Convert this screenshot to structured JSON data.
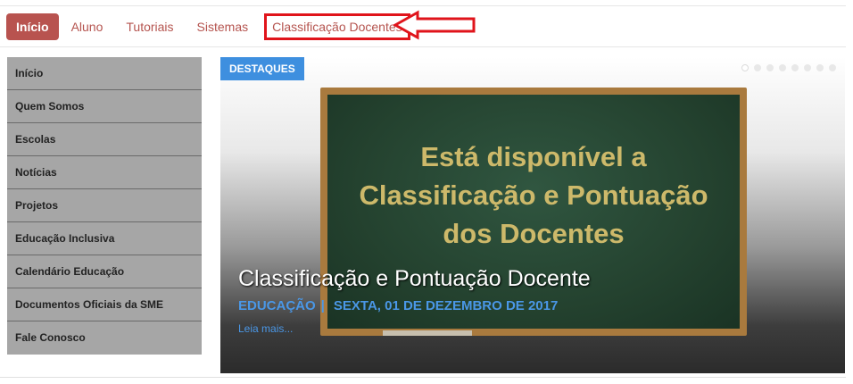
{
  "topnav": {
    "items": [
      "Início",
      "Aluno",
      "Tutoriais",
      "Sistemas",
      "Classificação Docentes"
    ]
  },
  "sidebar": {
    "items": [
      "Início",
      "Quem Somos",
      "Escolas",
      "Notícias",
      "Projetos",
      "Educação Inclusiva",
      "Calendário Educação",
      "Documentos Oficiais da SME",
      "Fale Conosco"
    ]
  },
  "feature": {
    "badge": "DESTAQUES",
    "board_lines": [
      "Está disponível a",
      "Classificação e Pontuação",
      "dos Docentes"
    ],
    "title": "Classificação e Pontuação Docente",
    "category": "EDUCAÇÃO",
    "separator": "|",
    "date": "SEXTA, 01 DE DEZEMBRO DE 2017",
    "more": "Leia mais...",
    "slides_count": 8,
    "active_slide": 1
  },
  "colors": {
    "nav_active_bg": "#b8534f",
    "nav_text": "#b5544f",
    "highlight_red": "#e0141b",
    "badge_blue": "#3e8fdf",
    "sidebar_bg": "#a6a6a6",
    "chalk_text": "#cdb96a"
  }
}
